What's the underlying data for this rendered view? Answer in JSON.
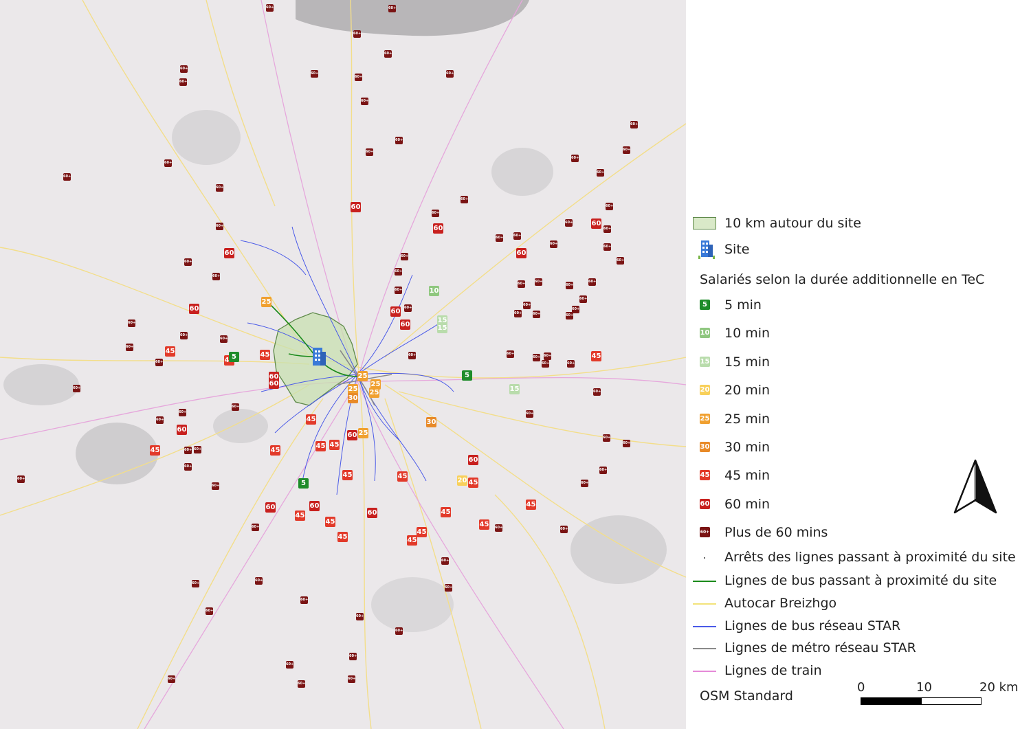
{
  "legend": {
    "buffer": "10 km autour du site",
    "site": "Site",
    "group_title": "Salariés selon la durée additionnelle en TeC",
    "durations": [
      {
        "code": "5",
        "label": "5 min",
        "color": "#1e8c2a"
      },
      {
        "code": "10",
        "label": "10 min",
        "color": "#8fc77f"
      },
      {
        "code": "15",
        "label": "15 min",
        "color": "#b9dcac"
      },
      {
        "code": "20",
        "label": "20 min",
        "color": "#f8d05a"
      },
      {
        "code": "25",
        "label": "25 min",
        "color": "#f0a030"
      },
      {
        "code": "30",
        "label": "30 min",
        "color": "#e88a28"
      },
      {
        "code": "45",
        "label": "45 min",
        "color": "#e23a2a"
      },
      {
        "code": "60",
        "label": "60 min",
        "color": "#c8201e"
      },
      {
        "code": "60+",
        "label": "Plus de 60 mins",
        "color": "#7a1414"
      }
    ],
    "stops": "Arrêts des lignes passant à proximité du site",
    "lines": [
      {
        "label": "Lignes de bus passant à proximité du site",
        "color": "#1a8a1a"
      },
      {
        "label": "Autocar Breizhgo",
        "color": "#f3e37a"
      },
      {
        "label": "Lignes de bus réseau STAR",
        "color": "#4a5ae8"
      },
      {
        "label": "Lignes de métro réseau STAR",
        "color": "#8a8a8a"
      },
      {
        "label": "Lignes de train",
        "color": "#e58ad8"
      }
    ],
    "basemap": "OSM Standard"
  },
  "scale": {
    "labels": [
      "0",
      "10",
      "20 km"
    ]
  },
  "map": {
    "colors": {
      "background": "#ebe8ea",
      "buffer_fill": "#c8e0b0",
      "buffer_stroke": "#5f8a4a",
      "site": "#3a7ad8",
      "water": "#aaaaaa",
      "forest": "#c9c7c9"
    },
    "markers": [
      [
        "60+",
        0.521,
        0.047
      ],
      [
        "60+",
        0.393,
        0.011
      ],
      [
        "60+",
        0.572,
        0.012
      ],
      [
        "60+",
        0.566,
        0.074
      ],
      [
        "60+",
        0.458,
        0.101
      ],
      [
        "60+",
        0.523,
        0.106
      ],
      [
        "60+",
        0.656,
        0.101
      ],
      [
        "60+",
        0.268,
        0.095
      ],
      [
        "60+",
        0.267,
        0.113
      ],
      [
        "60+",
        0.532,
        0.139
      ],
      [
        "60+",
        0.924,
        0.171
      ],
      [
        "60+",
        0.582,
        0.193
      ],
      [
        "60+",
        0.539,
        0.209
      ],
      [
        "60+",
        0.913,
        0.206
      ],
      [
        "60+",
        0.245,
        0.224
      ],
      [
        "60+",
        0.838,
        0.217
      ],
      [
        "60+",
        0.098,
        0.243
      ],
      [
        "60+",
        0.875,
        0.237
      ],
      [
        "60+",
        0.32,
        0.258
      ],
      [
        "60+",
        0.677,
        0.274
      ],
      [
        "60",
        0.519,
        0.284
      ],
      [
        "60+",
        0.635,
        0.293
      ],
      [
        "60+",
        0.888,
        0.283
      ],
      [
        "60+",
        0.32,
        0.311
      ],
      [
        "60",
        0.639,
        0.313
      ],
      [
        "60",
        0.869,
        0.307
      ],
      [
        "60+",
        0.829,
        0.306
      ],
      [
        "60+",
        0.885,
        0.314
      ],
      [
        "60+",
        0.728,
        0.327
      ],
      [
        "60+",
        0.754,
        0.324
      ],
      [
        "60+",
        0.807,
        0.335
      ],
      [
        "60+",
        0.885,
        0.339
      ],
      [
        "60",
        0.334,
        0.347
      ],
      [
        "60+",
        0.59,
        0.352
      ],
      [
        "60",
        0.76,
        0.347
      ],
      [
        "60+",
        0.274,
        0.36
      ],
      [
        "60+",
        0.904,
        0.358
      ],
      [
        "60+",
        0.581,
        0.373
      ],
      [
        "60+",
        0.315,
        0.379
      ],
      [
        "60+",
        0.76,
        0.39
      ],
      [
        "60+",
        0.785,
        0.387
      ],
      [
        "60+",
        0.83,
        0.392
      ],
      [
        "60+",
        0.863,
        0.387
      ],
      [
        "60+",
        0.581,
        0.398
      ],
      [
        "10",
        0.633,
        0.399
      ],
      [
        "60+",
        0.768,
        0.419
      ],
      [
        "25",
        0.388,
        0.414
      ],
      [
        "60+",
        0.85,
        0.41
      ],
      [
        "60+",
        0.595,
        0.423
      ],
      [
        "60",
        0.283,
        0.424
      ],
      [
        "60+",
        0.755,
        0.43
      ],
      [
        "60+",
        0.782,
        0.431
      ],
      [
        "60+",
        0.839,
        0.425
      ],
      [
        "60+",
        0.83,
        0.433
      ],
      [
        "60",
        0.577,
        0.427
      ],
      [
        "60",
        0.591,
        0.445
      ],
      [
        "15",
        0.645,
        0.44
      ],
      [
        "15",
        0.645,
        0.45
      ],
      [
        "60+",
        0.192,
        0.443
      ],
      [
        "60+",
        0.268,
        0.46
      ],
      [
        "60+",
        0.326,
        0.465
      ],
      [
        "60+",
        0.189,
        0.476
      ],
      [
        "60+",
        0.601,
        0.488
      ],
      [
        "60+",
        0.744,
        0.486
      ],
      [
        "60+",
        0.782,
        0.491
      ],
      [
        "60+",
        0.798,
        0.489
      ],
      [
        "60+",
        0.795,
        0.499
      ],
      [
        "60+",
        0.832,
        0.499
      ],
      [
        "45",
        0.869,
        0.489
      ],
      [
        "45",
        0.248,
        0.482
      ],
      [
        "60+",
        0.232,
        0.497
      ],
      [
        "45",
        0.386,
        0.487
      ],
      [
        "45",
        0.334,
        0.494
      ],
      [
        "5",
        0.341,
        0.49
      ],
      [
        "5",
        0.681,
        0.515
      ],
      [
        "25",
        0.529,
        0.516
      ],
      [
        "60",
        0.399,
        0.517
      ],
      [
        "60",
        0.399,
        0.526
      ],
      [
        "25",
        0.548,
        0.527
      ],
      [
        "25",
        0.515,
        0.534
      ],
      [
        "25",
        0.546,
        0.539
      ],
      [
        "30",
        0.515,
        0.546
      ],
      [
        "15",
        0.75,
        0.534
      ],
      [
        "60+",
        0.112,
        0.533
      ],
      [
        "60+",
        0.87,
        0.538
      ],
      [
        "60+",
        0.343,
        0.558
      ],
      [
        "60+",
        0.266,
        0.566
      ],
      [
        "60+",
        0.772,
        0.568
      ],
      [
        "60+",
        0.233,
        0.576
      ],
      [
        "45",
        0.453,
        0.575
      ],
      [
        "30",
        0.629,
        0.579
      ],
      [
        "60",
        0.265,
        0.59
      ],
      [
        "60+",
        0.884,
        0.601
      ],
      [
        "60+",
        0.913,
        0.608
      ],
      [
        "60",
        0.514,
        0.597
      ],
      [
        "25",
        0.53,
        0.594
      ],
      [
        "45",
        0.467,
        0.612
      ],
      [
        "45",
        0.487,
        0.61
      ],
      [
        "45",
        0.226,
        0.618
      ],
      [
        "60+",
        0.274,
        0.618
      ],
      [
        "60+",
        0.288,
        0.617
      ],
      [
        "45",
        0.401,
        0.618
      ],
      [
        "60",
        0.69,
        0.631
      ],
      [
        "60+",
        0.274,
        0.64
      ],
      [
        "60+",
        0.879,
        0.645
      ],
      [
        "45",
        0.507,
        0.652
      ],
      [
        "45",
        0.587,
        0.654
      ],
      [
        "20",
        0.674,
        0.659
      ],
      [
        "45",
        0.69,
        0.662
      ],
      [
        "60+",
        0.031,
        0.657
      ],
      [
        "60+",
        0.314,
        0.667
      ],
      [
        "5",
        0.442,
        0.663
      ],
      [
        "60+",
        0.852,
        0.663
      ],
      [
        "45",
        0.774,
        0.692
      ],
      [
        "60",
        0.394,
        0.696
      ],
      [
        "60",
        0.458,
        0.694
      ],
      [
        "45",
        0.437,
        0.707
      ],
      [
        "60",
        0.543,
        0.704
      ],
      [
        "45",
        0.65,
        0.703
      ],
      [
        "45",
        0.481,
        0.716
      ],
      [
        "45",
        0.706,
        0.72
      ],
      [
        "60+",
        0.727,
        0.724
      ],
      [
        "60+",
        0.822,
        0.726
      ],
      [
        "60+",
        0.372,
        0.723
      ],
      [
        "45",
        0.615,
        0.73
      ],
      [
        "45",
        0.601,
        0.741
      ],
      [
        "45",
        0.499,
        0.737
      ],
      [
        "60+",
        0.649,
        0.77
      ],
      [
        "60+",
        0.285,
        0.801
      ],
      [
        "60+",
        0.377,
        0.797
      ],
      [
        "60+",
        0.654,
        0.806
      ],
      [
        "60+",
        0.305,
        0.838
      ],
      [
        "60+",
        0.443,
        0.823
      ],
      [
        "60+",
        0.525,
        0.846
      ],
      [
        "60+",
        0.582,
        0.866
      ],
      [
        "60+",
        0.515,
        0.901
      ],
      [
        "60+",
        0.422,
        0.912
      ],
      [
        "60+",
        0.439,
        0.938
      ],
      [
        "60+",
        0.513,
        0.932
      ],
      [
        "60+",
        0.25,
        0.932
      ]
    ]
  }
}
